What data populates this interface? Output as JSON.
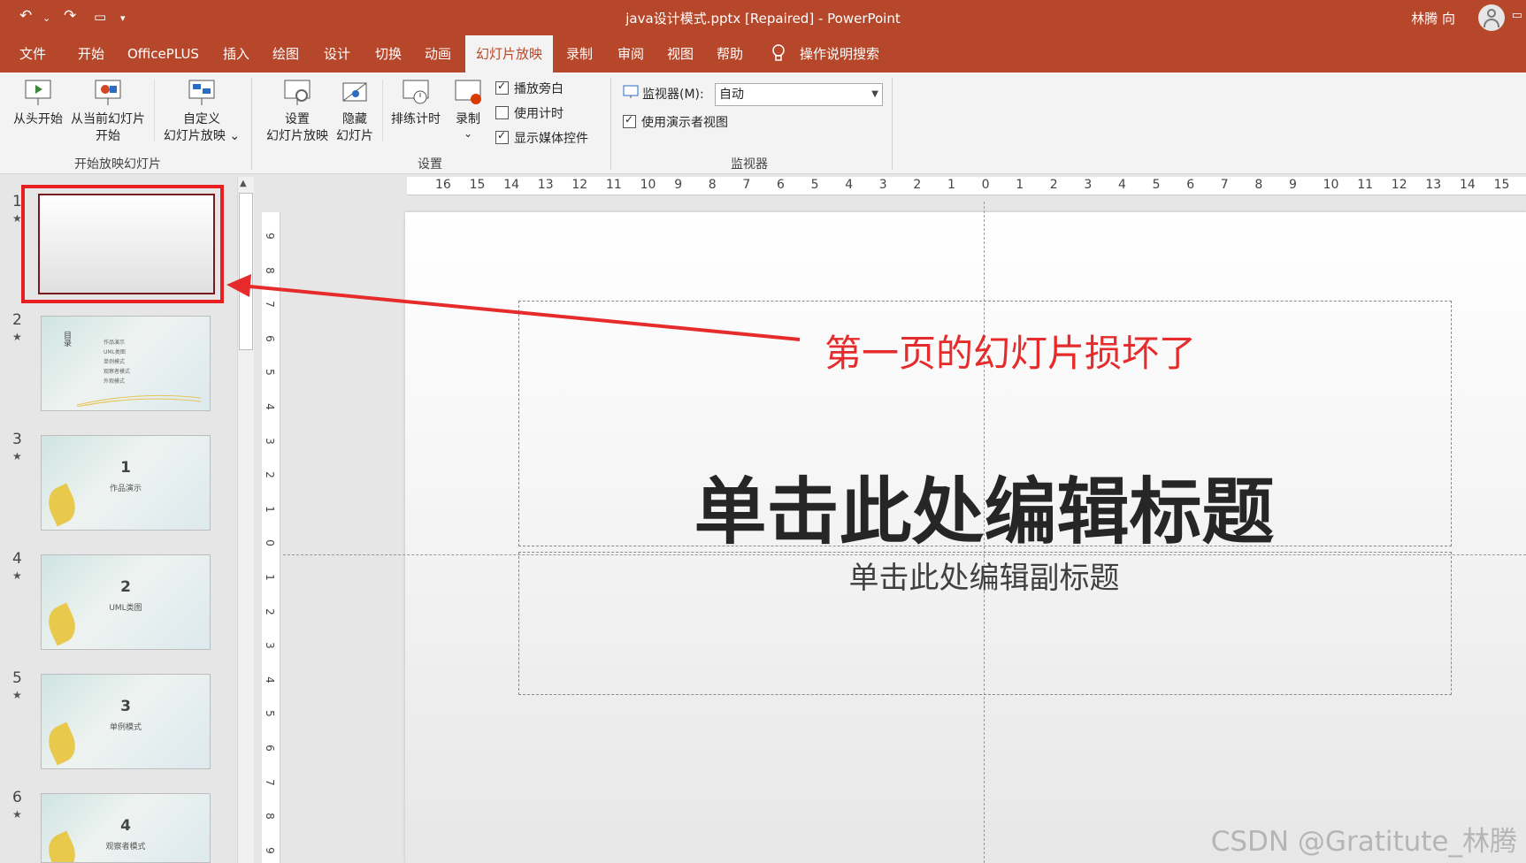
{
  "title_bar": {
    "doc_title": "java设计模式.pptx [Repaired]  -  PowerPoint",
    "user_name": "林腾 向"
  },
  "menu": {
    "tabs": [
      "文件",
      "开始",
      "OfficePLUS",
      "插入",
      "绘图",
      "设计",
      "切换",
      "动画",
      "幻灯片放映",
      "录制",
      "审阅",
      "视图",
      "帮助"
    ],
    "active_tab": "幻灯片放映",
    "search_label": "操作说明搜索"
  },
  "ribbon": {
    "from_beginning": "从头开始",
    "from_current_1": "从当前幻灯片",
    "from_current_2": "开始",
    "custom_1": "自定义",
    "custom_2": "幻灯片放映 ⌄",
    "group_start": "开始放映幻灯片",
    "setup_1": "设置",
    "setup_2": "幻灯片放映",
    "hide_1": "隐藏",
    "hide_2": "幻灯片",
    "rehearse": "排练计时",
    "record": "录制",
    "record_arrow": "⌄",
    "chk_narration": "播放旁白",
    "chk_timings": "使用计时",
    "chk_media": "显示媒体控件",
    "group_setup": "设置",
    "monitor_label": "监视器(M):",
    "monitor_value": "自动",
    "presenter_view": "使用演示者视图",
    "group_monitor": "监视器"
  },
  "thumbnails": [
    {
      "num": "1",
      "title": "",
      "subtitle": ""
    },
    {
      "num": "2",
      "title": "",
      "subtitle": ""
    },
    {
      "num": "3",
      "title": "1",
      "subtitle": "作品演示"
    },
    {
      "num": "4",
      "title": "2",
      "subtitle": "UML类图"
    },
    {
      "num": "5",
      "title": "3",
      "subtitle": "单例模式"
    },
    {
      "num": "6",
      "title": "4",
      "subtitle": "观察者模式"
    }
  ],
  "toc_label": "目录",
  "toc_items": [
    "作品演示",
    "UML类图",
    "单例模式",
    "观察者模式",
    "外观模式"
  ],
  "slide": {
    "title_placeholder": "单击此处编辑标题",
    "subtitle_placeholder": "单击此处编辑副标题"
  },
  "annotation": "第一页的幻灯片损坏了",
  "ruler_h": [
    "16",
    "15",
    "14",
    "13",
    "12",
    "11",
    "10",
    "9",
    "8",
    "7",
    "6",
    "5",
    "4",
    "3",
    "2",
    "1",
    "0",
    "1",
    "2",
    "3",
    "4",
    "5",
    "6",
    "7",
    "8",
    "9",
    "10",
    "11",
    "12",
    "13",
    "14",
    "15",
    "16"
  ],
  "ruler_v": [
    "9",
    "8",
    "7",
    "6",
    "5",
    "4",
    "3",
    "2",
    "1",
    "0",
    "1",
    "2",
    "3",
    "4",
    "5",
    "6",
    "7",
    "8",
    "9"
  ],
  "watermark": "CSDN @Gratitute_林腾",
  "colors": {
    "accent": "#b7472a",
    "annotation": "#e52b2b"
  }
}
